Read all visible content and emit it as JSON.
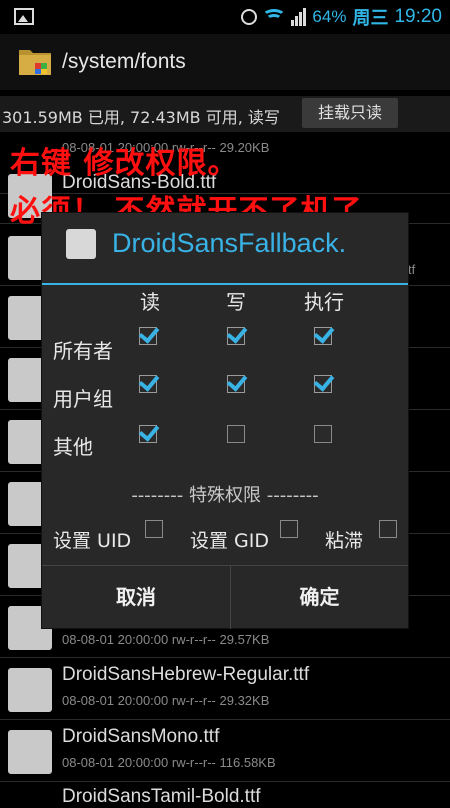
{
  "status_bar": {
    "battery": "64%",
    "day": "周三",
    "time": "19:20",
    "icons": [
      "image-icon",
      "alarm-icon",
      "wifi-icon",
      "signal-icon"
    ]
  },
  "path_bar": {
    "path": "/system/fonts"
  },
  "storage": {
    "info": "301.59MB 已用, 72.43MB 可用, 读写",
    "mount_button": "挂载只读"
  },
  "files": [
    {
      "name": "",
      "meta": "08-08-01 20:00:00  rw-r--r--  29.20KB"
    },
    {
      "name": "DroidSans-Bold.ttf",
      "meta": ""
    },
    {
      "name": "",
      "meta": "tf"
    },
    {
      "name": "",
      "meta": "29.57KB",
      "meta_full": "08-08-01 20:00:00  rw-r--r--  29.57KB"
    },
    {
      "name": "DroidSansHebrew-Regular.ttf",
      "meta": "08-08-01 20:00:00  rw-r--r--  29.32KB"
    },
    {
      "name": "DroidSansMono.ttf",
      "meta": "08-08-01 20:00:00  rw-r--r--  116.58KB"
    },
    {
      "name": "DroidSansTamil-Bold.ttf",
      "meta": ""
    }
  ],
  "annotation": {
    "line1": "右键  修改权限。",
    "line2": "必须！ 不然就开不了机了"
  },
  "dialog": {
    "title": "DroidSansFallback.",
    "columns": [
      "读",
      "写",
      "执行"
    ],
    "rows": [
      {
        "label": "所有者",
        "perms": [
          true,
          true,
          true
        ]
      },
      {
        "label": "用户组",
        "perms": [
          true,
          true,
          true
        ]
      },
      {
        "label": "其他",
        "perms": [
          true,
          false,
          false
        ]
      }
    ],
    "special_header": "-------- 特殊权限 --------",
    "special_opts": [
      {
        "label": "设置 UID",
        "checked": false
      },
      {
        "label": "设置 GID",
        "checked": false
      },
      {
        "label": "粘滞",
        "checked": false
      }
    ],
    "cancel": "取消",
    "ok": "确定"
  },
  "colors": {
    "accent": "#39b3e6",
    "annotation": "#ff1010"
  }
}
